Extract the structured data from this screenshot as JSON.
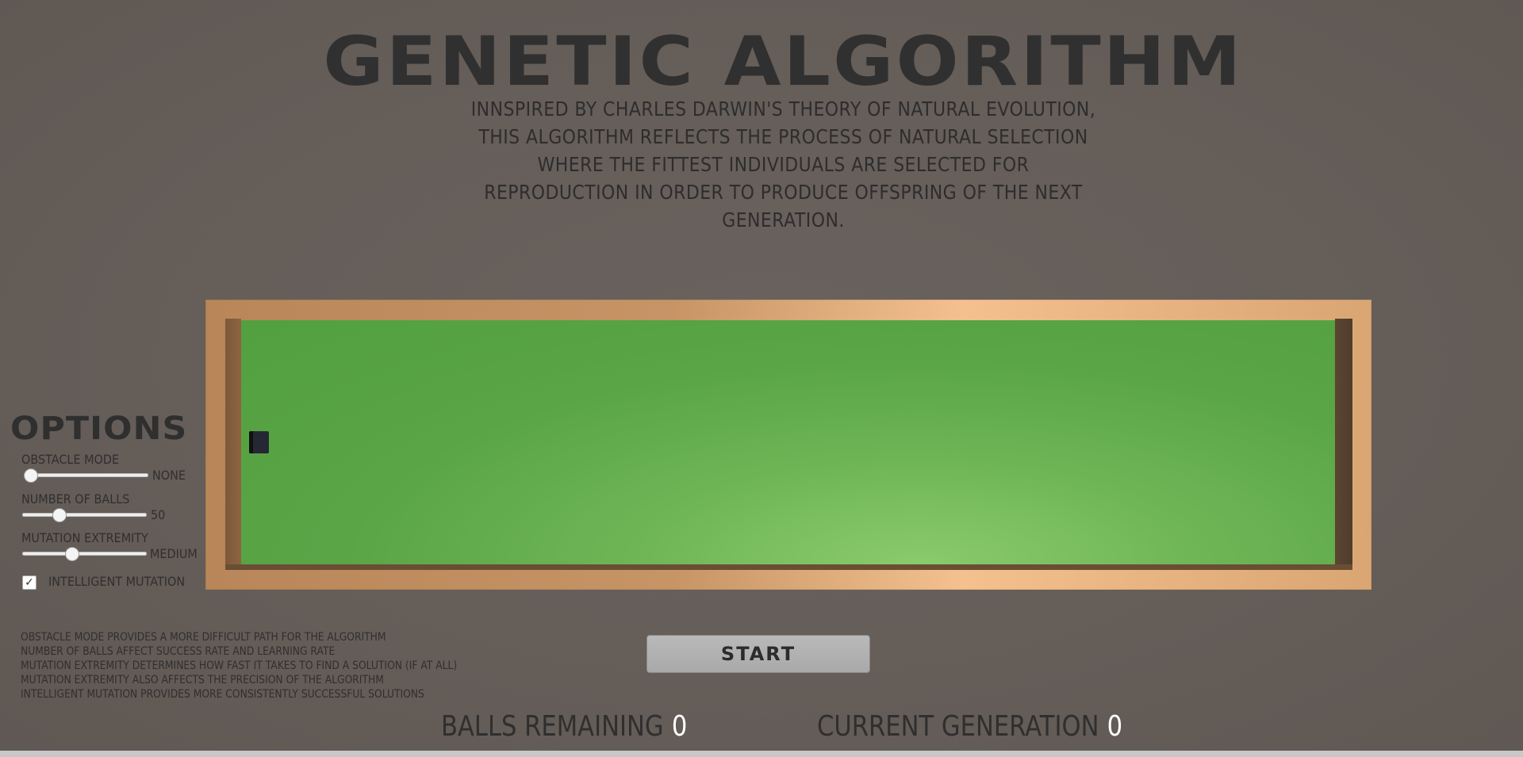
{
  "title": "GENETIC ALGORITHM",
  "description": "INNSPIRED BY CHARLES DARWIN'S THEORY OF NATURAL EVOLUTION, THIS ALGORITHM REFLECTS THE PROCESS OF NATURAL SELECTION WHERE THE FITTEST INDIVIDUALS ARE SELECTED FOR REPRODUCTION IN ORDER TO PRODUCE OFFSPRING OF THE NEXT GENERATION.",
  "options": {
    "title": "OPTIONS",
    "obstacle_mode": {
      "label": "OBSTACLE MODE",
      "value": "NONE",
      "level": 0.0
    },
    "number_of_balls": {
      "label": "NUMBER OF BALLS",
      "value": "50",
      "level": 0.27
    },
    "mutation_extremity": {
      "label": "MUTATION EXTREMITY",
      "value": "MEDIUM",
      "level": 0.38
    },
    "intelligent_mutation": {
      "label": "INTELLIGENT MUTATION",
      "checked": true,
      "check_glyph": "✓"
    }
  },
  "notes": [
    "OBSTACLE MODE PROVIDES A MORE DIFFICULT PATH FOR THE ALGORITHM",
    "NUMBER OF BALLS AFFECT SUCCESS RATE AND LEARNING RATE",
    "MUTATION EXTREMITY DETERMINES HOW FAST IT TAKES TO FIND A SOLUTION (IF AT ALL)",
    "MUTATION EXTREMITY ALSO AFFECTS THE PRECISION OF THE ALGORITHM",
    "INTELLIGENT MUTATION PROVIDES MORE CONSISTENTLY SUCCESSFUL SOLUTIONS"
  ],
  "start_label": "START",
  "stats": {
    "balls_remaining_label": "BALLS REMAINING",
    "balls_remaining_value": "0",
    "current_generation_label": "CURRENT GENERATION",
    "current_generation_value": "0"
  },
  "colors": {
    "background": "#665e59",
    "field_green": "#5aa546",
    "frame_tan": "#c79466",
    "value_white": "#ffffff"
  }
}
